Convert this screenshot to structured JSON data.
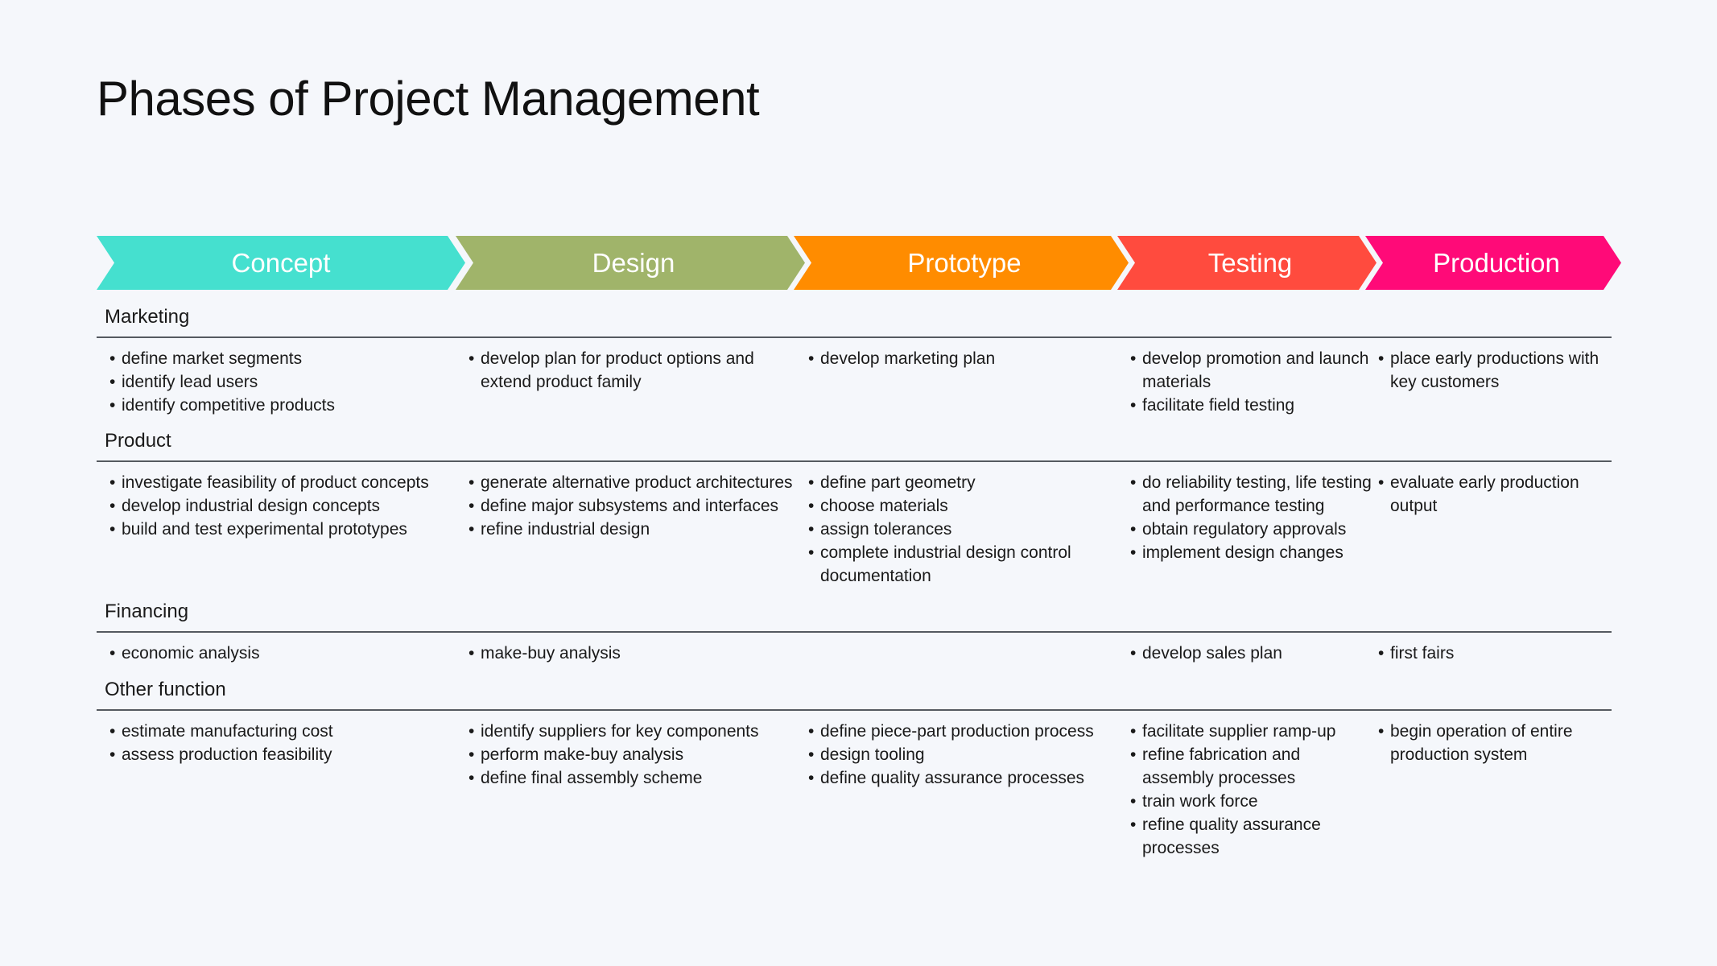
{
  "title": "Phases of Project Management",
  "phases": [
    {
      "label": "Concept",
      "color": "#45e0cf"
    },
    {
      "label": "Design",
      "color": "#a0b46a"
    },
    {
      "label": "Prototype",
      "color": "#ff8c00"
    },
    {
      "label": "Testing",
      "color": "#ff4b3e"
    },
    {
      "label": "Production",
      "color": "#ff0a78"
    }
  ],
  "sections": [
    {
      "title": "Marketing",
      "columns": [
        [
          "define market segments",
          "identify lead users",
          "identify competitive products"
        ],
        [
          "develop plan for product options and extend product family"
        ],
        [
          "develop marketing plan"
        ],
        [
          "develop promotion and launch materials",
          "facilitate field testing"
        ],
        [
          "place early productions with key customers"
        ]
      ]
    },
    {
      "title": "Product",
      "columns": [
        [
          "investigate feasibility of product concepts",
          "develop industrial design concepts",
          "build and test experimental prototypes"
        ],
        [
          "generate alternative product architectures",
          "define major subsystems and interfaces",
          "refine industrial design"
        ],
        [
          "define part geometry",
          "choose materials",
          "assign tolerances",
          "complete industrial design control documentation"
        ],
        [
          "do reliability testing, life testing and performance testing",
          "obtain regulatory approvals",
          "implement design changes"
        ],
        [
          "evaluate early production output"
        ]
      ]
    },
    {
      "title": "Financing",
      "columns": [
        [
          "economic analysis"
        ],
        [
          "make-buy analysis"
        ],
        [],
        [
          "develop sales plan"
        ],
        [
          "first fairs"
        ]
      ]
    },
    {
      "title": "Other function",
      "columns": [
        [
          "estimate manufacturing cost",
          "assess production feasibility"
        ],
        [
          "identify suppliers for key components",
          "perform make-buy analysis",
          "define final assembly scheme"
        ],
        [
          "define piece-part production process",
          "design tooling",
          "define quality assurance processes"
        ],
        [
          "facilitate supplier ramp-up",
          "refine fabrication and assembly processes",
          "train work force",
          "refine quality assurance processes"
        ],
        [
          "begin operation of entire production system"
        ]
      ]
    }
  ]
}
